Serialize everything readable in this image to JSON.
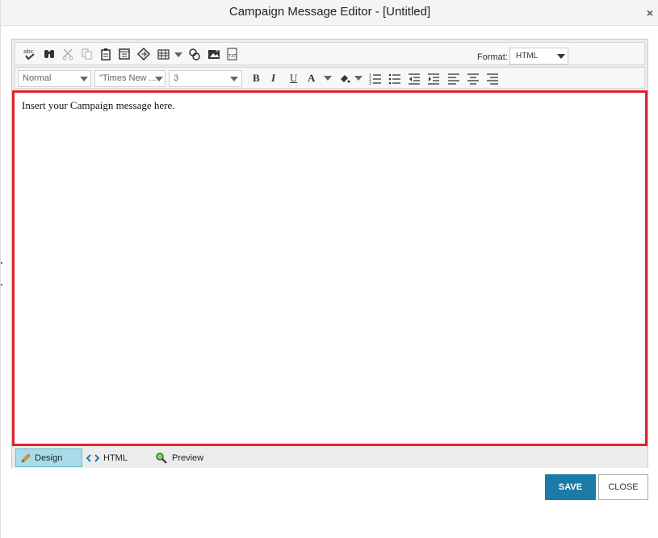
{
  "dialog": {
    "title": "Campaign Message Editor - [Untitled]",
    "close_glyph": "×"
  },
  "toolbar": {
    "icons": [
      "spellcheck-icon",
      "find-icon",
      "cut-icon",
      "copy-icon",
      "paste-icon",
      "paste-from-word-icon",
      "insert-link-icon",
      "insert-table-icon",
      "table-dropdown-icon",
      "insert-symbol-icon",
      "insert-image-icon",
      "insert-text-icon"
    ],
    "format_label": "Format:",
    "format_value": "HTML"
  },
  "toolbar2": {
    "paragraph_style": "Normal",
    "font_name": "\"Times New ...",
    "font_size": "3",
    "bold": "B",
    "italic": "I",
    "underline": "U",
    "font_color": "A"
  },
  "content": {
    "text": "Insert your Campaign message here."
  },
  "modes": {
    "design": "Design",
    "html": "HTML",
    "preview": "Preview"
  },
  "actions": {
    "save": "SAVE",
    "close": "CLOSE"
  },
  "colors": {
    "accent": "#1a7ba6",
    "content_border": "#e0242a",
    "active_tab": "#a9dcea"
  }
}
